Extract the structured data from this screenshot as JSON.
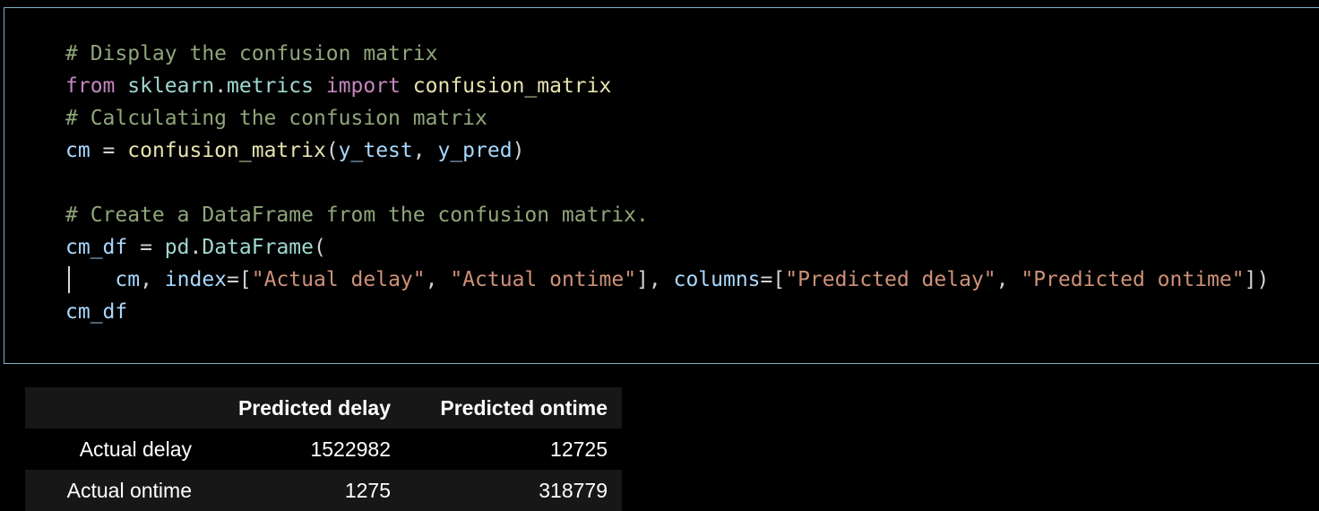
{
  "code_cell": {
    "lines": [
      [
        {
          "t": "# Display the confusion matrix",
          "c": "cmt"
        }
      ],
      [
        {
          "t": "from",
          "c": "kw"
        },
        {
          "t": " ",
          "c": "pun"
        },
        {
          "t": "sklearn",
          "c": "mod"
        },
        {
          "t": ".",
          "c": "pun"
        },
        {
          "t": "metrics",
          "c": "mod"
        },
        {
          "t": " ",
          "c": "pun"
        },
        {
          "t": "import",
          "c": "kw"
        },
        {
          "t": " ",
          "c": "pun"
        },
        {
          "t": "confusion_matrix",
          "c": "fn"
        }
      ],
      [
        {
          "t": "# Calculating the confusion matrix",
          "c": "cmt"
        }
      ],
      [
        {
          "t": "cm",
          "c": "var"
        },
        {
          "t": " = ",
          "c": "pun"
        },
        {
          "t": "confusion_matrix",
          "c": "fn"
        },
        {
          "t": "(",
          "c": "pun"
        },
        {
          "t": "y_test",
          "c": "var"
        },
        {
          "t": ", ",
          "c": "pun"
        },
        {
          "t": "y_pred",
          "c": "var"
        },
        {
          "t": ")",
          "c": "pun"
        }
      ],
      [],
      [
        {
          "t": "# Create a DataFrame from the confusion matrix.",
          "c": "cmt"
        }
      ],
      [
        {
          "t": "cm_df",
          "c": "var"
        },
        {
          "t": " = ",
          "c": "pun"
        },
        {
          "t": "pd",
          "c": "mod"
        },
        {
          "t": ".",
          "c": "pun"
        },
        {
          "t": "DataFrame",
          "c": "mod"
        },
        {
          "t": "(",
          "c": "pun"
        }
      ],
      [
        {
          "t": "    ",
          "c": "pun"
        },
        {
          "t": "cm",
          "c": "var"
        },
        {
          "t": ", ",
          "c": "pun"
        },
        {
          "t": "index",
          "c": "var"
        },
        {
          "t": "=[",
          "c": "pun"
        },
        {
          "t": "\"Actual delay\"",
          "c": "str"
        },
        {
          "t": ", ",
          "c": "pun"
        },
        {
          "t": "\"Actual ontime\"",
          "c": "str"
        },
        {
          "t": "], ",
          "c": "pun"
        },
        {
          "t": "columns",
          "c": "var"
        },
        {
          "t": "=[",
          "c": "pun"
        },
        {
          "t": "\"Predicted delay\"",
          "c": "str"
        },
        {
          "t": ", ",
          "c": "pun"
        },
        {
          "t": "\"Predicted ontime\"",
          "c": "str"
        },
        {
          "t": "])",
          "c": "pun"
        }
      ],
      [
        {
          "t": "cm_df",
          "c": "var"
        }
      ]
    ]
  },
  "output_table": {
    "columns": [
      "",
      "Predicted delay",
      "Predicted ontime"
    ],
    "rows": [
      {
        "label": "Actual delay",
        "values": [
          "1522982",
          "12725"
        ]
      },
      {
        "label": "Actual ontime",
        "values": [
          "1275",
          "318779"
        ]
      }
    ]
  }
}
